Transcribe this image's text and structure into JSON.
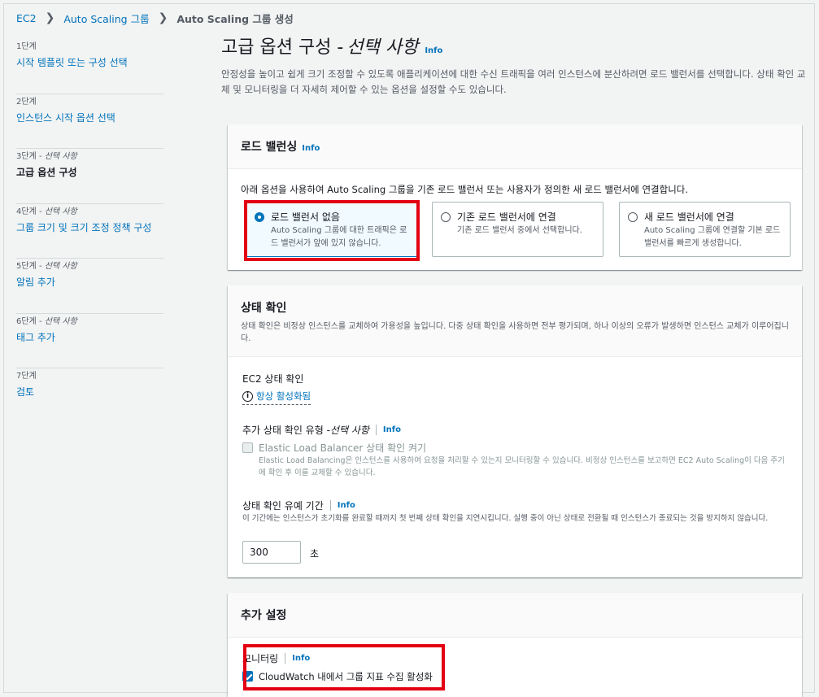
{
  "breadcrumb": {
    "items": [
      "EC2",
      "Auto Scaling 그룹"
    ],
    "current": "Auto Scaling 그룹 생성"
  },
  "sidebar": {
    "steps": [
      {
        "num": "1단계",
        "optional": "",
        "name": "시작 템플릿 또는 구성 선택",
        "active": false
      },
      {
        "num": "2단계",
        "optional": "",
        "name": "인스턴스 시작 옵션 선택",
        "active": false
      },
      {
        "num": "3단계 - ",
        "optional": "선택 사항",
        "name": "고급 옵션 구성",
        "active": true
      },
      {
        "num": "4단계 - ",
        "optional": "선택 사항",
        "name": "그룹 크기 및 크기 조정 정책 구성",
        "active": false
      },
      {
        "num": "5단계 - ",
        "optional": "선택 사항",
        "name": "알림 추가",
        "active": false
      },
      {
        "num": "6단계 - ",
        "optional": "선택 사항",
        "name": "태그 추가",
        "active": false
      },
      {
        "num": "7단계",
        "optional": "",
        "name": "검토",
        "active": false
      }
    ]
  },
  "page": {
    "title": "고급 옵션 구성 - ",
    "title_optional": "선택 사항",
    "info": "Info",
    "description": "안정성을 높이고 쉽게 크기 조정할 수 있도록 애플리케이션에 대한 수신 트래픽을 여러 인스턴스에 분산하려면 로드 밸런서를 선택합니다. 상태 확인 교체 및 모니터링을 더 자세히 제어할 수 있는 옵션을 설정할 수도 있습니다."
  },
  "load_balancing": {
    "title": "로드 밸런싱",
    "info": "Info",
    "instruction": "아래 옵션을 사용하여 Auto Scaling 그룹을 기존 로드 밸런서 또는 사용자가 정의한 새 로드 밸런서에 연결합니다.",
    "options": [
      {
        "label": "로드 밸런서 없음",
        "desc": "Auto Scaling 그룹에 대한 트래픽은 로드 밸런서가 앞에 있지 않습니다.",
        "selected": true
      },
      {
        "label": "기존 로드 밸런서에 연결",
        "desc": "기존 로드 밸런서 중에서 선택합니다.",
        "selected": false
      },
      {
        "label": "새 로드 밸런서에 연결",
        "desc": "Auto Scaling 그룹에 연결할 기본 로드 밸런서를 빠르게 생성합니다.",
        "selected": false
      }
    ]
  },
  "health_check": {
    "title": "상태 확인",
    "description": "상태 확인은 비정상 인스턴스를 교체하여 가용성을 높입니다. 다중 상태 확인을 사용하면 전부 평가되며, 하나 이상의 오류가 발생하면 인스턴스 교체가 이루어집니다.",
    "ec2_label": "EC2 상태 확인",
    "ec2_status": "항상 활성화됨",
    "additional_label": "추가 상태 확인 유형 - ",
    "additional_optional": "선택 사항",
    "info": "Info",
    "elb_label": "Elastic Load Balancer 상태 확인 켜기",
    "elb_desc": "Elastic Load Balancing은 인스턴스를 사용하여 요청을 처리할 수 있는지 모니터링할 수 있습니다. 비정상 인스턴스를 보고하면 EC2 Auto Scaling이 다음 주기에 확인 후 이를 교체할 수 있습니다.",
    "grace_label": "상태 확인 유예 기간",
    "grace_desc": "이 기간에는 인스턴스가 초기화를 완료할 때까지 첫 번째 상태 확인을 지연시킵니다. 실행 중이 아닌 상태로 전환될 때 인스턴스가 종료되는 것을 방지하지 않습니다.",
    "grace_value": "300",
    "grace_unit": "초"
  },
  "additional": {
    "title": "추가 설정",
    "monitoring_label": "모니터링",
    "info": "Info",
    "cloudwatch_label": "CloudWatch 내에서 그룹 지표 수집 활성화",
    "cloudwatch_checked": true
  },
  "colors": {
    "link": "#0073bb",
    "highlight_border": "#e30013",
    "selected_bg": "#f1faff"
  }
}
